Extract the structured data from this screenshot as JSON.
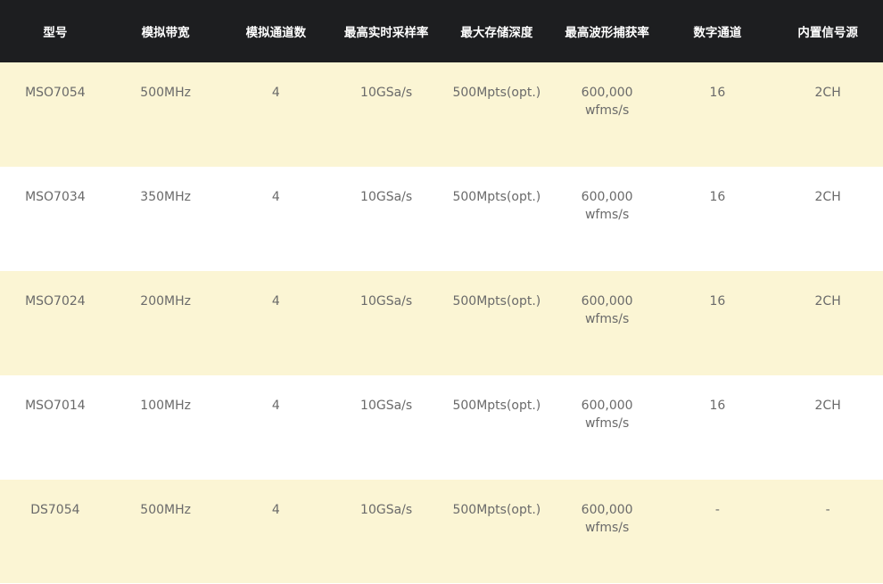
{
  "table": {
    "headers": [
      "型号",
      "模拟带宽",
      "模拟通道数",
      "最高实时采样率",
      "最大存储深度",
      "最高波形捕获率",
      "数字通道",
      "内置信号源"
    ],
    "rows": [
      {
        "model": "MSO7054",
        "bandwidth": "500MHz",
        "analog_channels": "4",
        "sample_rate": "10GSa/s",
        "memory_depth": "500Mpts(opt.)",
        "waveform_rate": "600,000",
        "waveform_rate_unit": "wfms/s",
        "digital_channels": "16",
        "signal_source": "2CH"
      },
      {
        "model": "MSO7034",
        "bandwidth": "350MHz",
        "analog_channels": "4",
        "sample_rate": "10GSa/s",
        "memory_depth": "500Mpts(opt.)",
        "waveform_rate": "600,000",
        "waveform_rate_unit": "wfms/s",
        "digital_channels": "16",
        "signal_source": "2CH"
      },
      {
        "model": "MSO7024",
        "bandwidth": "200MHz",
        "analog_channels": "4",
        "sample_rate": "10GSa/s",
        "memory_depth": "500Mpts(opt.)",
        "waveform_rate": "600,000",
        "waveform_rate_unit": "wfms/s",
        "digital_channels": "16",
        "signal_source": "2CH"
      },
      {
        "model": "MSO7014",
        "bandwidth": "100MHz",
        "analog_channels": "4",
        "sample_rate": "10GSa/s",
        "memory_depth": "500Mpts(opt.)",
        "waveform_rate": "600,000",
        "waveform_rate_unit": "wfms/s",
        "digital_channels": "16",
        "signal_source": "2CH"
      },
      {
        "model": "DS7054",
        "bandwidth": "500MHz",
        "analog_channels": "4",
        "sample_rate": "10GSa/s",
        "memory_depth": "500Mpts(opt.)",
        "waveform_rate": "600,000",
        "waveform_rate_unit": "wfms/s",
        "digital_channels": "-",
        "signal_source": "-"
      }
    ]
  },
  "colors": {
    "header_bg": "#1d1e20",
    "header_text": "#ffffff",
    "row_odd_bg": "#fbf5d4",
    "row_even_bg": "#ffffff",
    "cell_text": "#6a6a6a"
  }
}
